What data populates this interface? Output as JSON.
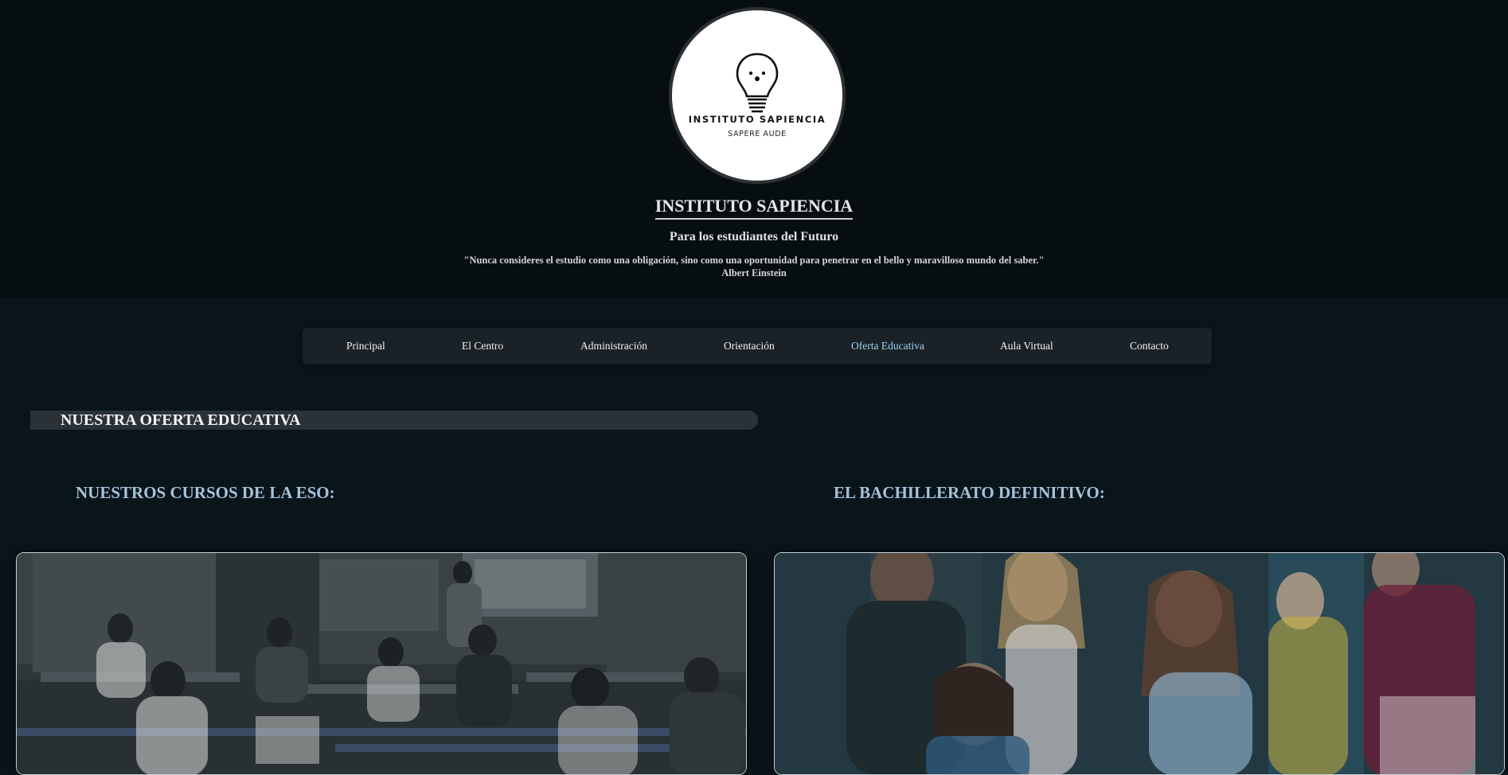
{
  "header": {
    "logo": {
      "name": "INSTITUTO SAPIENCIA",
      "motto": "SAPERE AUDE",
      "icon": "lightbulb-icon"
    },
    "title": "INSTITUTO SAPIENCIA",
    "subtitle": "Para los estudiantes del Futuro",
    "quote": "\"Nunca consideres el estudio como una obligación, sino como una oportunidad para penetrar en el bello y maravilloso mundo del saber.\"",
    "quote_author": "Albert Einstein"
  },
  "nav": {
    "items": [
      {
        "label": "Principal"
      },
      {
        "label": "El Centro"
      },
      {
        "label": "Administración"
      },
      {
        "label": "Orientación"
      },
      {
        "label": "Oferta Educativa"
      },
      {
        "label": "Aula Virtual"
      },
      {
        "label": "Contacto"
      }
    ],
    "active": "Oferta Educativa"
  },
  "section": {
    "title": "NUESTRA OFERTA EDUCATIVA"
  },
  "columns": [
    {
      "heading": "NUESTROS CURSOS DE LA ESO:",
      "image": "classroom-photo"
    },
    {
      "heading": "EL BACHILLERATO DEFINITIVO:",
      "image": "celebrating-students-photo"
    }
  ],
  "colors": {
    "background": "#0a141b",
    "header_background": "#060e12",
    "nav_background": "#1a2227",
    "active_nav": "#9fd0ee",
    "column_heading": "#a7c3d8"
  }
}
